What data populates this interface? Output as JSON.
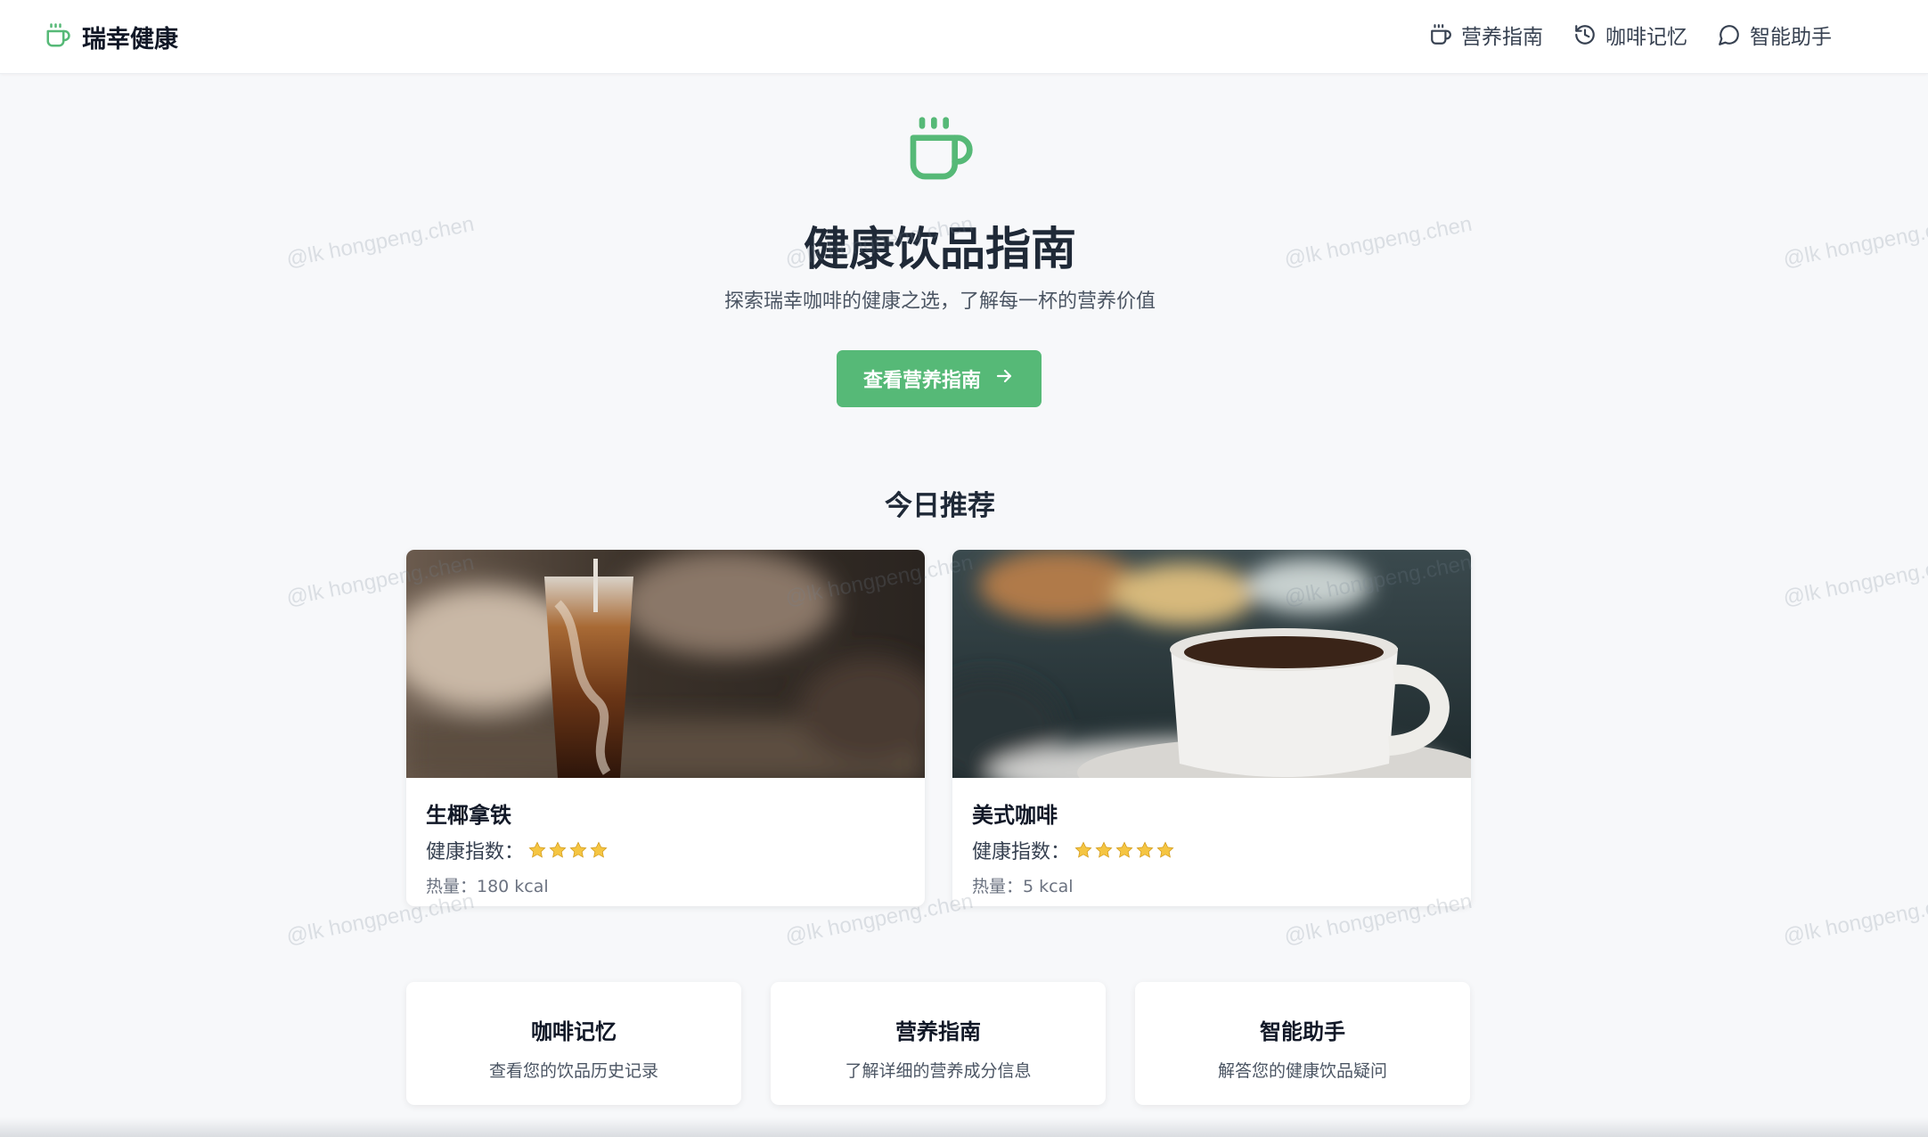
{
  "header": {
    "brand": "瑞幸健康",
    "nav": [
      {
        "label": "营养指南",
        "icon": "coffee-cup-icon"
      },
      {
        "label": "咖啡记忆",
        "icon": "history-icon"
      },
      {
        "label": "智能助手",
        "icon": "chat-bubble-icon"
      }
    ]
  },
  "hero": {
    "icon": "coffee-cup-icon",
    "title": "健康饮品指南",
    "subtitle": "探索瑞幸咖啡的健康之选，了解每一杯的营养价值",
    "cta_label": "查看营养指南",
    "cta_icon": "arrow-right-icon"
  },
  "recommend": {
    "title": "今日推荐",
    "items": [
      {
        "name": "生椰拿铁",
        "health_label": "健康指数：",
        "health_stars": 4,
        "calories": "热量：180 kcal",
        "image": "iced-latte-photo"
      },
      {
        "name": "美式咖啡",
        "health_label": "健康指数：",
        "health_stars": 5,
        "calories": "热量：5 kcal",
        "image": "americano-cup-photo"
      }
    ]
  },
  "features": [
    {
      "title": "咖啡记忆",
      "desc": "查看您的饮品历史记录"
    },
    {
      "title": "营养指南",
      "desc": "了解详细的营养成分信息"
    },
    {
      "title": "智能助手",
      "desc": "解答您的健康饮品疑问"
    }
  ],
  "watermark": "@lk hongpeng.chen",
  "colors": {
    "accent": "#56b977",
    "star": "#f5c542",
    "background": "#f7f8fa"
  }
}
